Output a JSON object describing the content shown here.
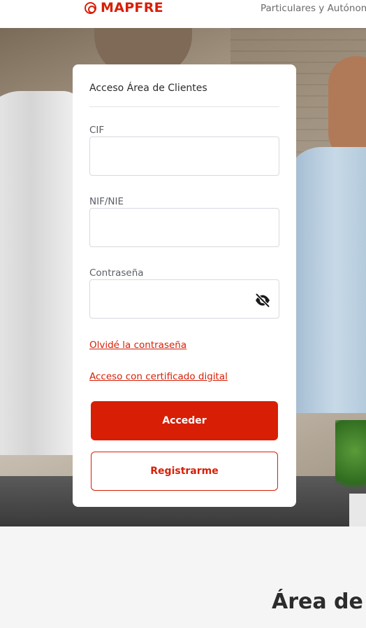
{
  "header": {
    "logo_text": "MAPFRE",
    "segment_label": "Particulares y Autónom"
  },
  "login": {
    "title": "Acceso Área de Clientes",
    "cif": {
      "label": "CIF",
      "value": ""
    },
    "nif": {
      "label": "NIF/NIE",
      "value": ""
    },
    "password": {
      "label": "Contraseña",
      "value": ""
    },
    "forgot_password": "Olvidé la contraseña",
    "digital_certificate": "Acceso con certificado digital",
    "submit_label": "Acceder",
    "register_label": "Registrarme"
  },
  "section": {
    "title": "Área de"
  },
  "colors": {
    "brand": "#d81e05",
    "text": "#2c2c2c",
    "label": "#5a5f66",
    "border": "#d6d9dd",
    "page_bg": "#f5f5f5"
  },
  "icons": {
    "logo": "mapfre-logo-icon",
    "password_toggle": "eye-slash-icon"
  }
}
